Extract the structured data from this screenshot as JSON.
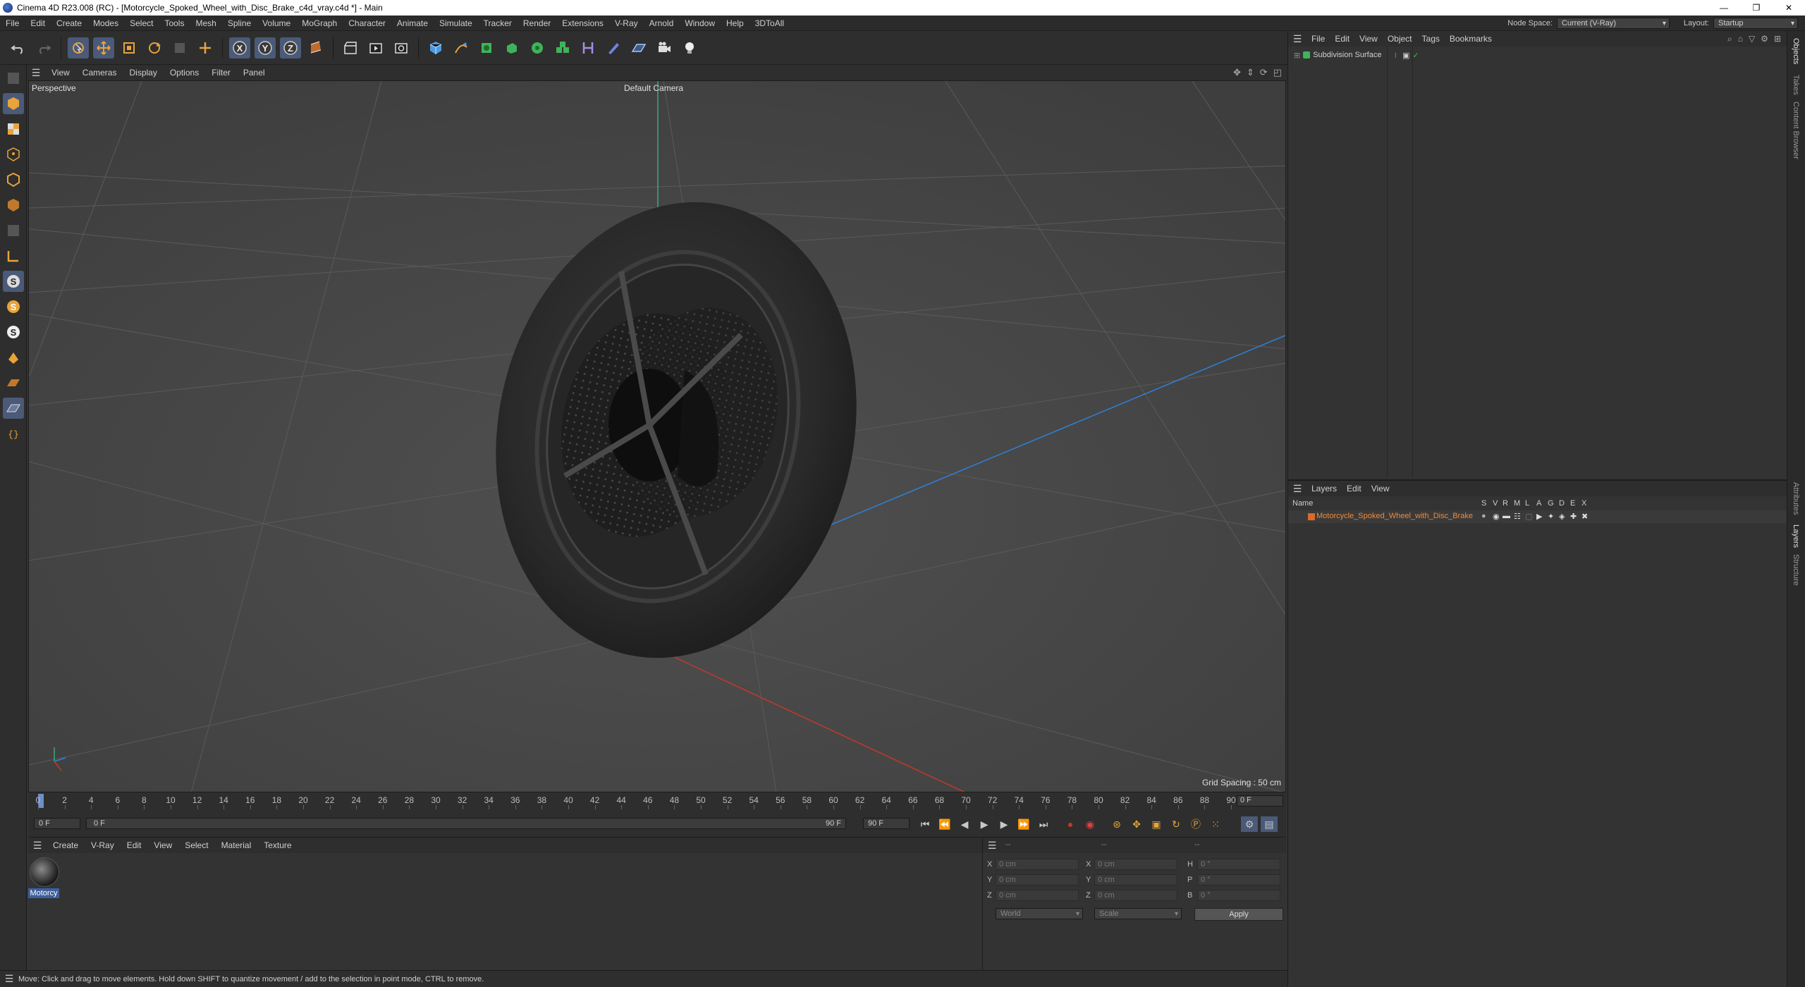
{
  "window": {
    "title": "Cinema 4D R23.008 (RC) - [Motorcycle_Spoked_Wheel_with_Disc_Brake_c4d_vray.c4d *] - Main",
    "controls": [
      "—",
      "❐",
      "✕"
    ]
  },
  "menubar": {
    "items": [
      "File",
      "Edit",
      "Create",
      "Modes",
      "Select",
      "Tools",
      "Mesh",
      "Spline",
      "Volume",
      "MoGraph",
      "Character",
      "Animate",
      "Simulate",
      "Tracker",
      "Render",
      "Extensions",
      "V-Ray",
      "Arnold",
      "Window",
      "Help",
      "3DToAll"
    ],
    "node_space_label": "Node Space:",
    "node_space_value": "Current (V-Ray)",
    "layout_label": "Layout:",
    "layout_value": "Startup"
  },
  "toolbar": {
    "axes": [
      "X",
      "Y",
      "Z"
    ]
  },
  "viewport": {
    "menu": [
      "View",
      "Cameras",
      "Display",
      "Options",
      "Filter",
      "Panel"
    ],
    "view_name": "Perspective",
    "camera": "Default Camera",
    "grid_spacing": "Grid Spacing : 50 cm"
  },
  "timeline": {
    "ticks": [
      "0",
      "2",
      "4",
      "6",
      "8",
      "10",
      "12",
      "14",
      "16",
      "18",
      "20",
      "22",
      "24",
      "26",
      "28",
      "30",
      "32",
      "34",
      "36",
      "38",
      "40",
      "42",
      "44",
      "46",
      "48",
      "50",
      "52",
      "54",
      "56",
      "58",
      "60",
      "62",
      "64",
      "66",
      "68",
      "70",
      "72",
      "74",
      "76",
      "78",
      "80",
      "82",
      "84",
      "86",
      "88",
      "90"
    ],
    "current_frame": "0 F"
  },
  "transport": {
    "start": "0 F",
    "slider_start": "0 F",
    "slider_end": "90 F",
    "end": "90 F"
  },
  "material_panel": {
    "menu": [
      "Create",
      "V-Ray",
      "Edit",
      "View",
      "Select",
      "Material",
      "Texture"
    ],
    "material_name": "Motorcy"
  },
  "coordinates": {
    "header_dashes": [
      "--",
      "--",
      "--"
    ],
    "rows": [
      {
        "a": "X",
        "a_val": "0 cm",
        "b": "X",
        "b_val": "0 cm",
        "c": "H",
        "c_val": "0 °"
      },
      {
        "a": "Y",
        "a_val": "0 cm",
        "b": "Y",
        "b_val": "0 cm",
        "c": "P",
        "c_val": "0 °"
      },
      {
        "a": "Z",
        "a_val": "0 cm",
        "b": "Z",
        "b_val": "0 cm",
        "c": "B",
        "c_val": "0 °"
      }
    ],
    "space": "World",
    "mode": "Scale",
    "apply": "Apply"
  },
  "status": {
    "message": "Move: Click and drag to move elements. Hold down SHIFT to quantize movement / add to the selection in point mode, CTRL to remove."
  },
  "objects_panel": {
    "menu": [
      "File",
      "Edit",
      "View",
      "Object",
      "Tags",
      "Bookmarks"
    ],
    "object_name": "Subdivision Surface"
  },
  "layers_panel": {
    "menu": [
      "Layers",
      "Edit",
      "View"
    ],
    "name_header": "Name",
    "flag_headers": [
      "S",
      "V",
      "R",
      "M",
      "L",
      "A",
      "G",
      "D",
      "E",
      "X"
    ],
    "layer_name": "Motorcycle_Spoked_Wheel_with_Disc_Brake"
  },
  "side_tabs": [
    "Objects",
    "Takes",
    "Content Browser",
    "Attributes",
    "Layers",
    "Structure"
  ],
  "colors": {
    "accent_blue": "#4a5a78",
    "layer_orange": "#f08a3a",
    "axis_x": "#c0392b",
    "axis_y": "#2ecc71",
    "axis_z": "#2f7fd6"
  }
}
